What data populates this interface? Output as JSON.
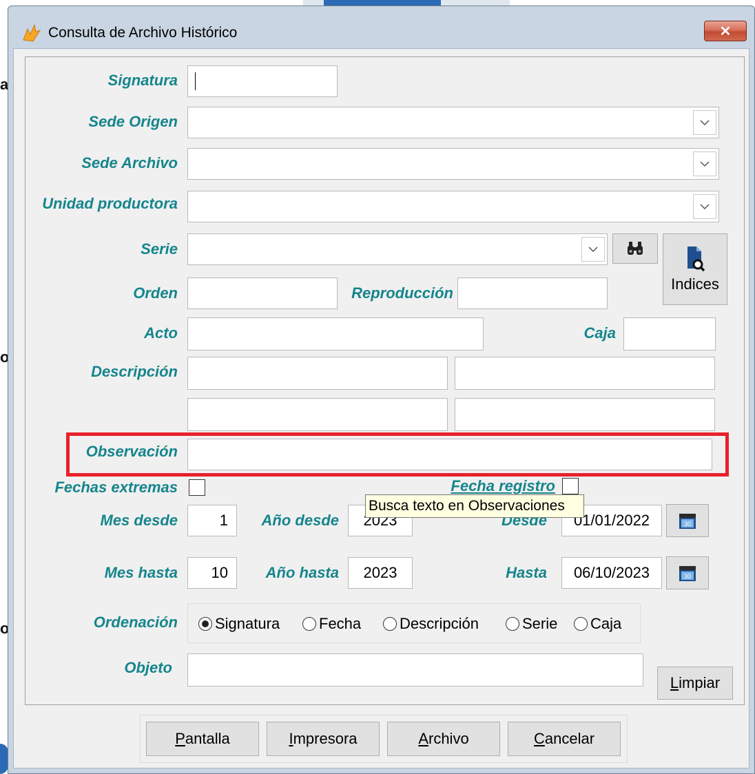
{
  "window": {
    "title": "Consulta de Archivo Histórico",
    "close_label": "✕"
  },
  "background": {
    "fragments": [
      "a",
      "o",
      "o"
    ]
  },
  "form": {
    "signatura": {
      "label": "Signatura",
      "value": ""
    },
    "sede_origen": {
      "label": "Sede Origen",
      "value": ""
    },
    "sede_archivo": {
      "label": "Sede Archivo",
      "value": ""
    },
    "unidad_productora": {
      "label": "Unidad productora",
      "value": ""
    },
    "serie": {
      "label": "Serie",
      "value": ""
    },
    "indices_button": "Indices",
    "orden": {
      "label": "Orden",
      "value": ""
    },
    "reproduccion": {
      "label": "Reproducción",
      "value": ""
    },
    "acto": {
      "label": "Acto",
      "value": ""
    },
    "caja": {
      "label": "Caja",
      "value": ""
    },
    "descripcion": {
      "label": "Descripción",
      "values": [
        "",
        "",
        "",
        ""
      ]
    },
    "observacion": {
      "label": "Observación",
      "value": ""
    },
    "fechas_extremas": {
      "label": "Fechas extremas",
      "checked": false
    },
    "fecha_registro": {
      "label": "Fecha registro",
      "checked": false
    },
    "mes_desde": {
      "label": "Mes desde",
      "value": "1"
    },
    "anio_desde": {
      "label": "Año desde",
      "value": "2023"
    },
    "desde": {
      "label": "Desde",
      "value": "01/01/2022"
    },
    "mes_hasta": {
      "label": "Mes hasta",
      "value": "10"
    },
    "anio_hasta": {
      "label": "Año hasta",
      "value": "2023"
    },
    "hasta": {
      "label": "Hasta",
      "value": "06/10/2023"
    },
    "calendar_day": "30",
    "ordenacion": {
      "label": "Ordenación",
      "options": [
        "Signatura",
        "Fecha",
        "Descripción",
        "Serie",
        "Caja"
      ],
      "selected": "Signatura"
    },
    "objeto": {
      "label": "Objeto",
      "value": ""
    },
    "limpiar_button": {
      "hotkey": "L",
      "rest": "impiar"
    }
  },
  "tooltip": "Busca texto en Observaciones",
  "buttons": {
    "pantalla": {
      "hotkey": "P",
      "rest": "antalla"
    },
    "impresora": {
      "hotkey": "I",
      "rest": "mpresora"
    },
    "archivo": {
      "hotkey": "A",
      "rest": "rchivo"
    },
    "cancelar": {
      "hotkey": "C",
      "rest": "ancelar"
    }
  },
  "colors": {
    "label": "#15858c",
    "highlight": "#e8202a",
    "tooltip_bg": "#ffffe1"
  },
  "icons": [
    "app-icon",
    "close-icon",
    "chevron-down-icon",
    "binoculars-icon",
    "document-search-icon",
    "calendar-icon"
  ]
}
